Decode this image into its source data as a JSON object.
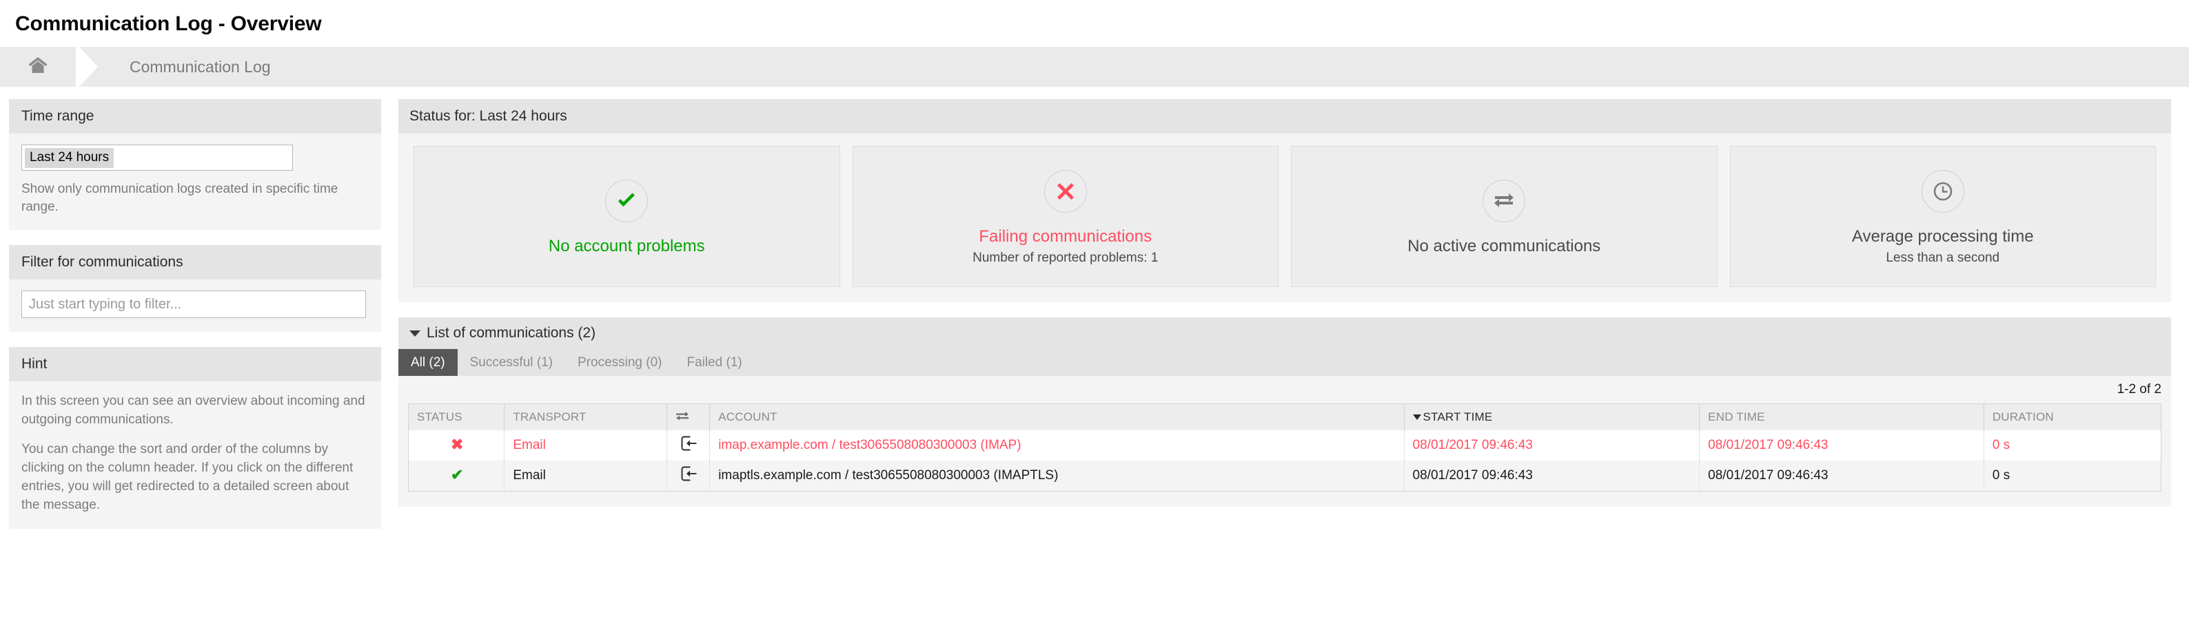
{
  "header": {
    "title": "Communication Log - Overview"
  },
  "breadcrumb": {
    "home_icon": "home-icon",
    "items": [
      {
        "label": "Communication Log"
      }
    ]
  },
  "sidebar": {
    "time_range": {
      "heading": "Time range",
      "selected": "Last 24 hours",
      "description": "Show only communication logs created in specific time range."
    },
    "filter": {
      "heading": "Filter for communications",
      "placeholder": "Just start typing to filter...",
      "value": ""
    },
    "hint": {
      "heading": "Hint",
      "paragraphs": [
        "In this screen you can see an overview about incoming and outgoing communications.",
        "You can change the sort and order of the columns by clicking on the column header. If you click on the different entries, you will get redirected to a detailed screen about the message."
      ]
    }
  },
  "status": {
    "heading": "Status for: Last 24 hours",
    "cards": [
      {
        "icon": "check-circle-icon",
        "title": "No account problems",
        "subtitle": "",
        "tone": "green"
      },
      {
        "icon": "times-circle-icon",
        "title": "Failing communications",
        "subtitle": "Number of reported problems: 1",
        "tone": "red"
      },
      {
        "icon": "exchange-icon",
        "title": "No active communications",
        "subtitle": "",
        "tone": "neutral"
      },
      {
        "icon": "clock-icon",
        "title": "Average processing time",
        "subtitle": "Less than a second",
        "tone": "neutral"
      }
    ]
  },
  "list": {
    "heading": "List of communications (2)",
    "collapse_icon": "caret-down-icon",
    "tabs": [
      {
        "label": "All (2)",
        "active": true
      },
      {
        "label": "Successful (1)",
        "active": false
      },
      {
        "label": "Processing (0)",
        "active": false
      },
      {
        "label": "Failed (1)",
        "active": false
      }
    ],
    "pager": "1-2 of 2",
    "columns": [
      {
        "key": "status",
        "label": "STATUS",
        "sorted": false
      },
      {
        "key": "transport",
        "label": "TRANSPORT",
        "sorted": false
      },
      {
        "key": "direction",
        "label": "",
        "sorted": false,
        "icon": "exchange-icon"
      },
      {
        "key": "account",
        "label": "ACCOUNT",
        "sorted": false
      },
      {
        "key": "start",
        "label": "START TIME",
        "sorted": true
      },
      {
        "key": "end",
        "label": "END TIME",
        "sorted": false
      },
      {
        "key": "duration",
        "label": "DURATION",
        "sorted": false
      }
    ],
    "rows": [
      {
        "state": "failed",
        "status_icon": "times-icon",
        "transport": "Email",
        "direction_icon": "sign-in-inbound-icon",
        "account": "imap.example.com / test3065508080300003 (IMAP)",
        "start": "08/01/2017 09:46:43",
        "end": "08/01/2017 09:46:43",
        "duration": "0 s"
      },
      {
        "state": "successful",
        "status_icon": "check-icon",
        "transport": "Email",
        "direction_icon": "sign-in-inbound-icon",
        "account": "imaptls.example.com / test3065508080300003 (IMAPTLS)",
        "start": "08/01/2017 09:46:43",
        "end": "08/01/2017 09:46:43",
        "duration": "0 s"
      }
    ]
  },
  "colors": {
    "success_green": "#00a400",
    "error_red": "#ff4d5e",
    "row_check_green": "#19a119",
    "active_tab_bg": "#575757",
    "panel_head_bg": "#e4e4e4",
    "panel_body_bg": "#f4f4f4",
    "card_bg": "#ededed"
  }
}
